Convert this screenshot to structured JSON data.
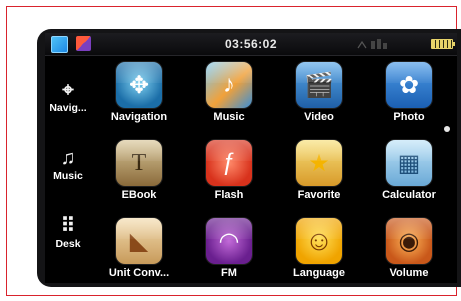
{
  "status_bar": {
    "time": "03:56:02",
    "icons": [
      "app-switch-icon",
      "color-theme-icon",
      "gps-signal-icon",
      "battery-icon"
    ]
  },
  "sidebar": {
    "items": [
      {
        "label": "Navig...",
        "icon": "compass-crosshair-icon",
        "glyph": "⌖"
      },
      {
        "label": "Music",
        "icon": "music-note-icon",
        "glyph": "♫"
      },
      {
        "label": "Desk",
        "icon": "grid-icon",
        "glyph": "⠿"
      }
    ]
  },
  "apps": [
    {
      "label": "Navigation",
      "icon": "navigation-compass-icon",
      "glyph": "✥"
    },
    {
      "label": "Music",
      "icon": "music-icon",
      "glyph": "♪"
    },
    {
      "label": "Video",
      "icon": "clapperboard-icon",
      "glyph": "🎬"
    },
    {
      "label": "Photo",
      "icon": "photo-icon",
      "glyph": "✿"
    },
    {
      "label": "EBook",
      "icon": "book-icon",
      "glyph": "T"
    },
    {
      "label": "Flash",
      "icon": "flash-icon",
      "glyph": "ƒ"
    },
    {
      "label": "Favorite",
      "icon": "star-icon",
      "glyph": "★"
    },
    {
      "label": "Calculator",
      "icon": "calculator-icon",
      "glyph": "▦"
    },
    {
      "label": "Unit Conv...",
      "icon": "ruler-triangle-icon",
      "glyph": "◣"
    },
    {
      "label": "FM",
      "icon": "radio-waves-icon",
      "glyph": "◠"
    },
    {
      "label": "Language",
      "icon": "smiley-icon",
      "glyph": "☺"
    },
    {
      "label": "Volume",
      "icon": "speaker-icon",
      "glyph": "◉"
    }
  ],
  "colors": {
    "frame": "#d9232d",
    "screen": "#000000",
    "battery": "#e8d46a"
  }
}
